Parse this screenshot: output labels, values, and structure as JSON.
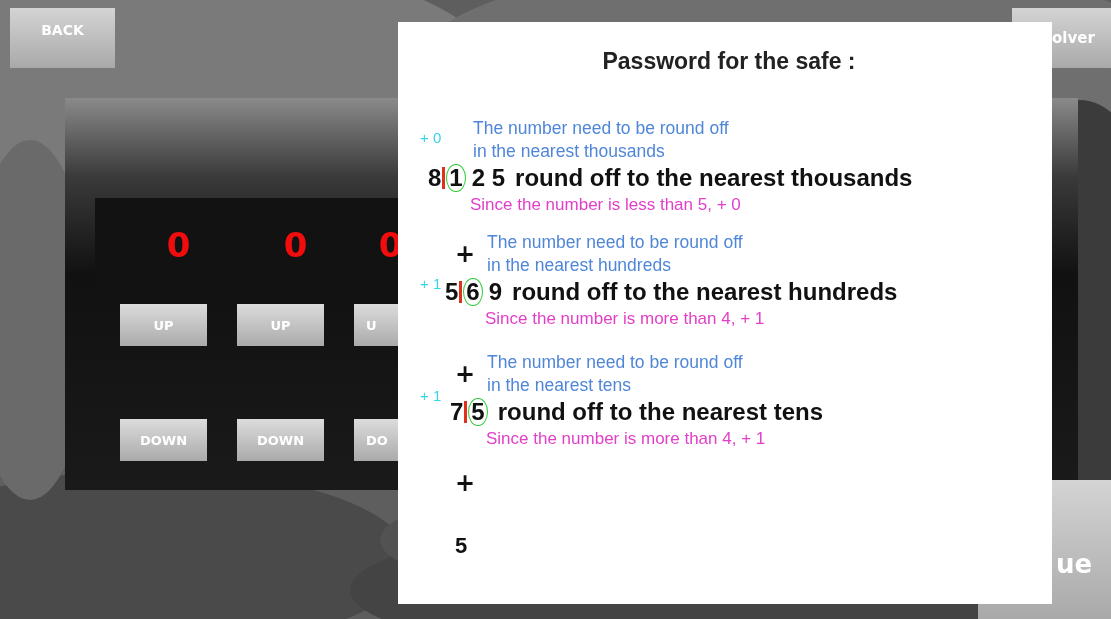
{
  "back_button": {
    "label": "BACK"
  },
  "solver_button": {
    "label": "olver"
  },
  "continue_button": {
    "label": "ue"
  },
  "safe": {
    "digits": [
      "0",
      "0",
      "0"
    ],
    "up_buttons": [
      "UP",
      "UP",
      "U"
    ],
    "down_buttons": [
      "DOWN",
      "DOWN",
      "DO"
    ]
  },
  "dialog": {
    "title": "Password for the safe :",
    "steps": [
      {
        "note": [
          "The number need to be round off",
          "in the nearest thousands"
        ],
        "carry": "+ 0",
        "lead": "8",
        "circled": "1",
        "tail": "2 5",
        "text": "round off to the nearest thousands",
        "reason": "Since the number is less than 5, + 0"
      },
      {
        "plus": "+",
        "note": [
          "The number need to be round off",
          "in the nearest hundreds"
        ],
        "carry": "+ 1",
        "lead": "5",
        "circled": "6",
        "tail": "9",
        "text": "round off to the nearest hundreds",
        "reason": "Since the number is more than 4, + 1"
      },
      {
        "plus": "+",
        "note": [
          "The number need to be round off",
          "in the nearest tens"
        ],
        "carry": "+ 1",
        "lead": "7",
        "circled": "5",
        "text": "round off to the nearest tens",
        "reason": "Since the number is more than 4, + 1"
      }
    ],
    "result": {
      "plus": "+",
      "value": "5"
    }
  }
}
